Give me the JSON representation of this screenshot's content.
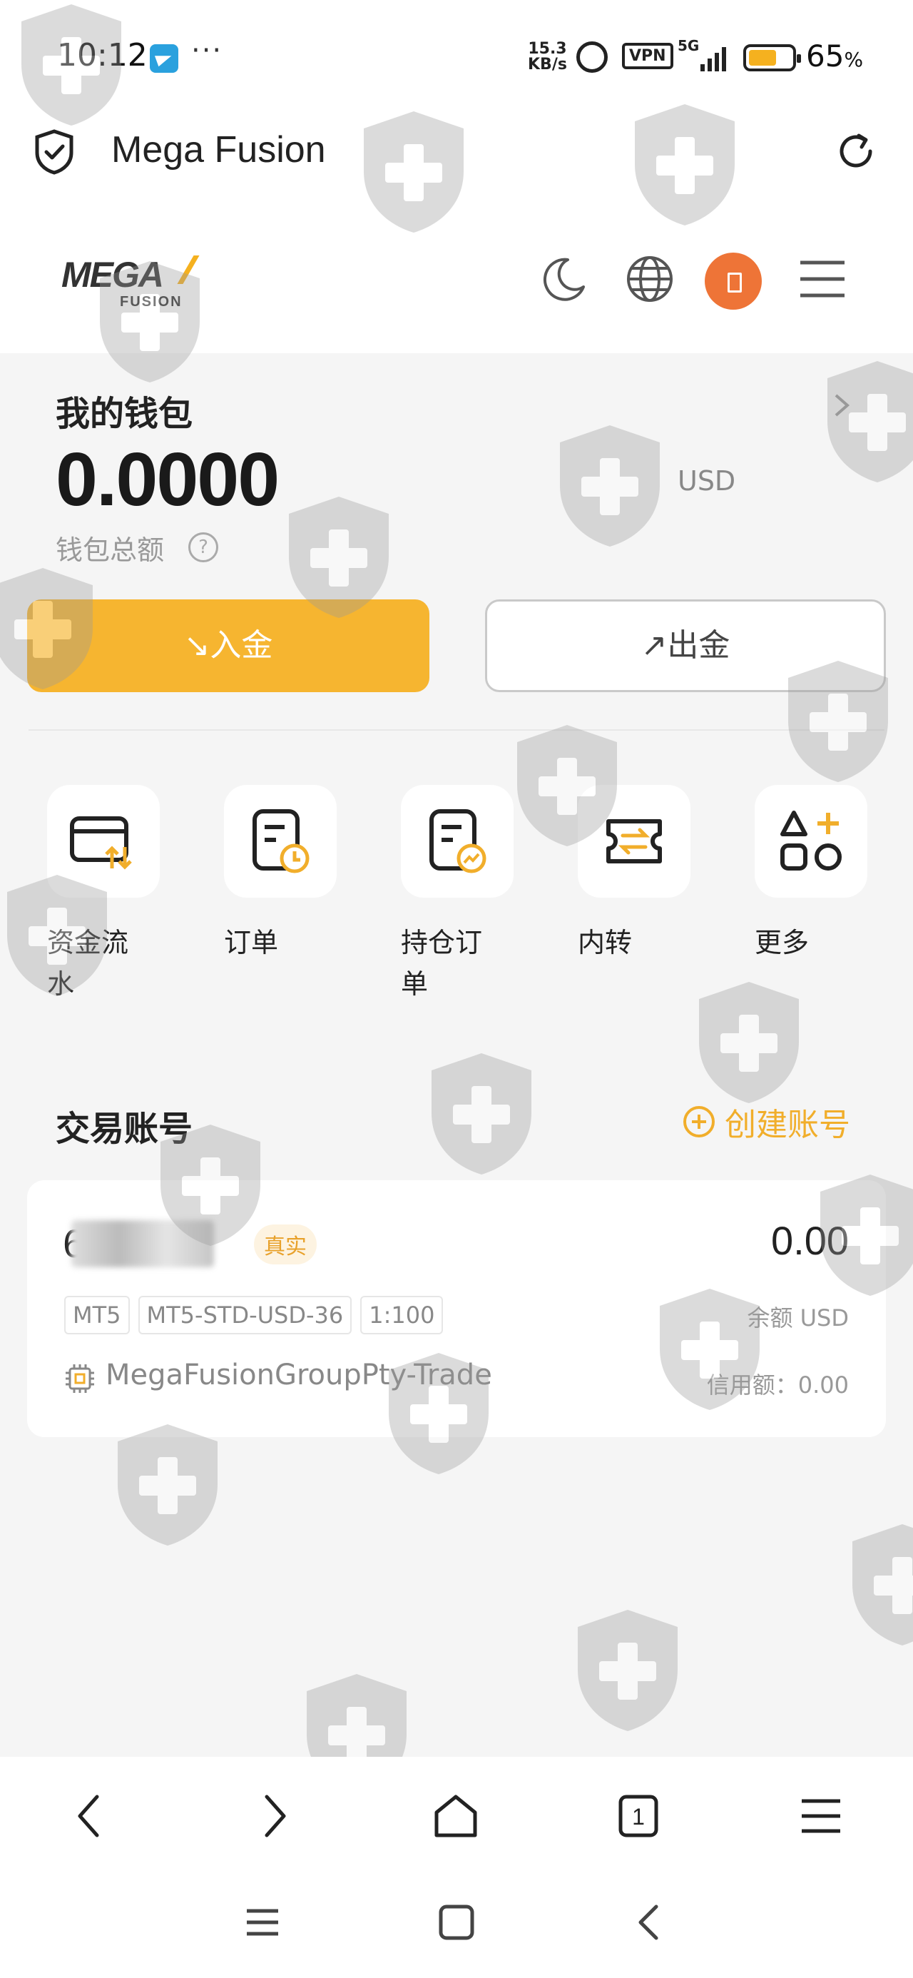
{
  "status_bar": {
    "time": "10:12",
    "more": "···",
    "speed_value": "15.3",
    "speed_unit": "KB/s",
    "vpn": "VPN",
    "network": "5G",
    "battery_pct_number": "65",
    "battery_pct_sign": "%",
    "battery_level": 0.65
  },
  "browser": {
    "site_title": "Mega Fusion"
  },
  "header": {
    "logo_main": "MEGA",
    "logo_sub": "FUSION",
    "accent_color": "#f6b530",
    "avatar_color": "#ee7437"
  },
  "wallet": {
    "title": "我的钱包",
    "amount": "0.0000",
    "currency": "USD",
    "subtitle": "钱包总额",
    "help": "?",
    "deposit_label": "↘入金",
    "withdraw_label": "↗出金"
  },
  "quick_actions": [
    {
      "label": "资金流\n水",
      "icon": "fund-flow-icon"
    },
    {
      "label": "订单",
      "icon": "order-icon"
    },
    {
      "label": "持仓订\n单",
      "icon": "position-order-icon"
    },
    {
      "label": "内转",
      "icon": "transfer-icon"
    },
    {
      "label": "更多",
      "icon": "more-apps-icon"
    }
  ],
  "trade_accounts": {
    "title": "交易账号",
    "create_label": "创建账号",
    "account": {
      "number_visible": "6        9",
      "type_badge": "真实",
      "balance": "0.00",
      "tags": [
        "MT5",
        "MT5-STD-USD-36",
        "1:100"
      ],
      "balance_label": "余额 USD",
      "server": "MegaFusionGroupPty-Trade",
      "credit": "信用额：0.00"
    }
  },
  "browser_nav": {
    "tab_count": "1"
  }
}
